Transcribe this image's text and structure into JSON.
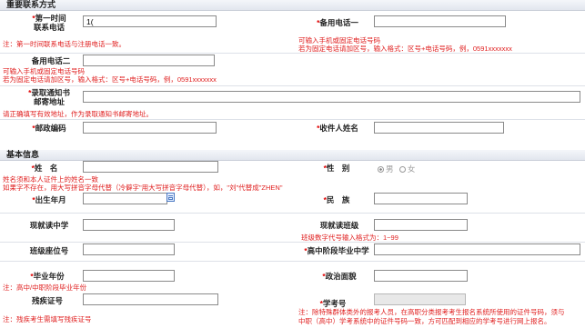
{
  "contact": {
    "section_title": "重要联系方式",
    "first_phone_label_1": "第一时间",
    "first_phone_label_2": "联系电话",
    "first_phone_value": "1(",
    "backup_phone1_label": "备用电话一",
    "first_phone_note": "注：第一时间联系电话与注册电话一致。",
    "backup1_note_1": "可输入手机或固定电话号码",
    "backup1_note_2": "若为固定电话请加区号，输入格式：区号+电话号码，例，0591xxxxxxx",
    "backup_phone2_label": "备用电话二",
    "backup2_note_1": "可输入手机或固定电话号码",
    "backup2_note_2": "若为固定电话请加区号，输入格式：区号+电话号码，例，0591xxxxxxx",
    "address_label_1": "录取通知书",
    "address_label_2": "邮寄地址",
    "address_note": "请正确填写有效地址，作为录取通知书邮寄地址。",
    "postcode_label": "邮政编码",
    "recipient_label": "收件人姓名"
  },
  "basic": {
    "section_title": "基本信息",
    "name_label": "姓　名",
    "gender_label": "性　别",
    "gender_male": "男",
    "gender_female": "女",
    "name_note_1": "姓名须和本人证件上的姓名一致",
    "name_note_2": "如果字不存在，用大写拼音字母代替（冷僻字\"用大写拼音字母代替），如，\"刘\"代替成\"ZHEN\"",
    "birth_label": "出生年月",
    "ethnicity_label": "民　族",
    "school_label": "现就读中学",
    "class_label": "现就读班级",
    "class_note": "班级数字代号输入格式为：1~99",
    "seat_label": "班级座位号",
    "grad_school_label": "高中阶段毕业中学",
    "grad_year_label": "毕业年份",
    "political_label": "政治面貌",
    "grad_year_note": "注：高中/中职阶段毕业年份",
    "disability_label": "残疾证号",
    "student_no_label": "学考号",
    "disability_note": "注：残疾考生需填写残疾证号",
    "student_no_note_1": "注：除特殊群体类外的报考人员，在高职分类报考考生报名系统所使用的证件号码，须与",
    "student_no_note_2": "中职（高中）学考系统中的证件号码一致，方可匹配到相应的学考号进行网上报名。"
  },
  "required_mark": "*",
  "colors": {
    "note": "#e02020",
    "required": "#e00000",
    "header_bg": "#e8ebf1"
  },
  "icons": {
    "calendar": "calendar-icon"
  }
}
